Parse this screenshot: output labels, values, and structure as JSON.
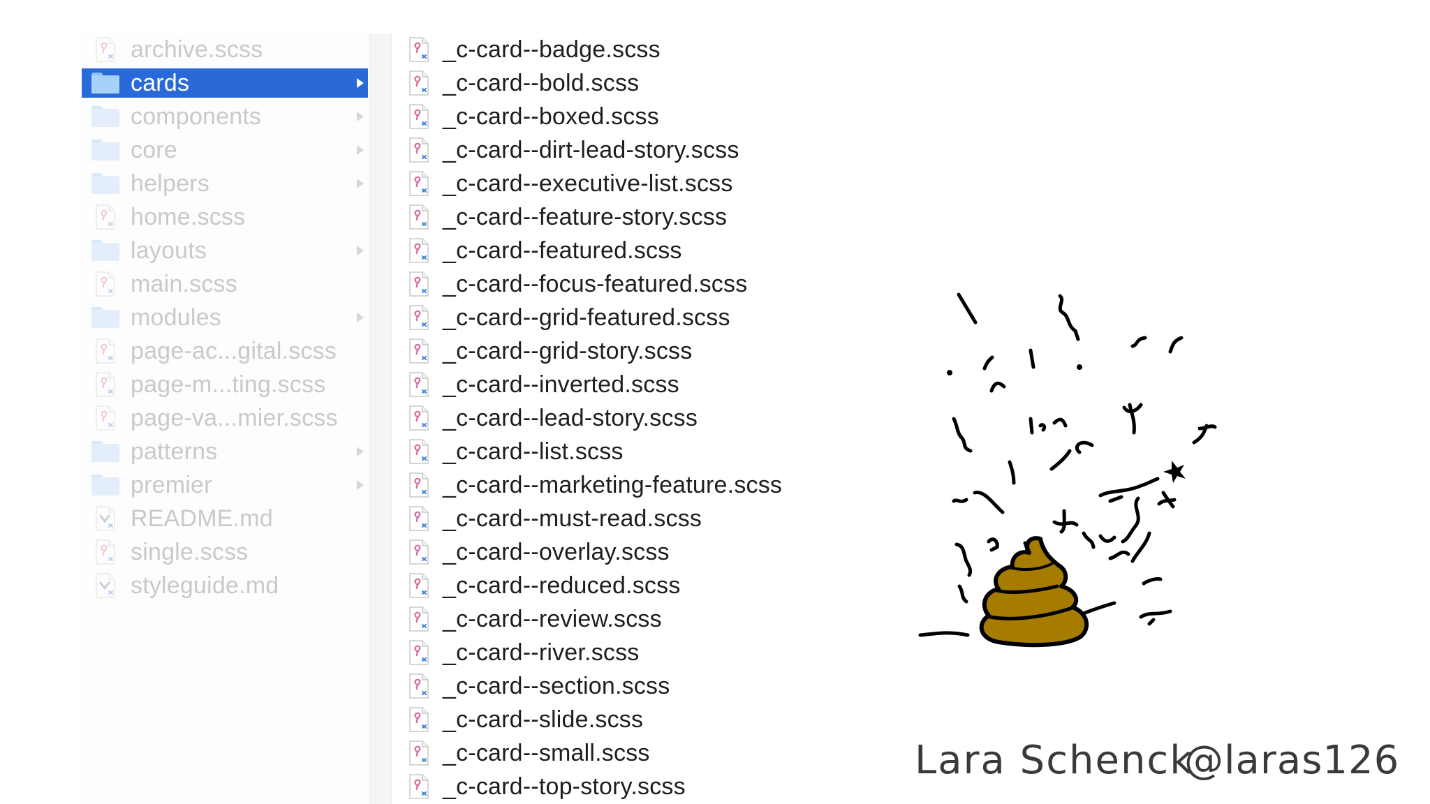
{
  "parent_directory": {
    "items": [
      {
        "label": "archive.scss",
        "kind": "scss"
      },
      {
        "label": "cards",
        "kind": "folder",
        "selected": true
      },
      {
        "label": "components",
        "kind": "folder"
      },
      {
        "label": "core",
        "kind": "folder"
      },
      {
        "label": "helpers",
        "kind": "folder"
      },
      {
        "label": "home.scss",
        "kind": "scss"
      },
      {
        "label": "layouts",
        "kind": "folder"
      },
      {
        "label": "main.scss",
        "kind": "scss"
      },
      {
        "label": "modules",
        "kind": "folder"
      },
      {
        "label": "page-ac...gital.scss",
        "kind": "scss"
      },
      {
        "label": "page-m...ting.scss",
        "kind": "scss"
      },
      {
        "label": "page-va...mier.scss",
        "kind": "scss"
      },
      {
        "label": "patterns",
        "kind": "folder"
      },
      {
        "label": "premier",
        "kind": "folder"
      },
      {
        "label": "README.md",
        "kind": "md"
      },
      {
        "label": "single.scss",
        "kind": "scss"
      },
      {
        "label": "styleguide.md",
        "kind": "md"
      }
    ]
  },
  "cards_directory": {
    "items": [
      "_c-card--badge.scss",
      "_c-card--bold.scss",
      "_c-card--boxed.scss",
      "_c-card--dirt-lead-story.scss",
      "_c-card--executive-list.scss",
      "_c-card--feature-story.scss",
      "_c-card--featured.scss",
      "_c-card--focus-featured.scss",
      "_c-card--grid-featured.scss",
      "_c-card--grid-story.scss",
      "_c-card--inverted.scss",
      "_c-card--lead-story.scss",
      "_c-card--list.scss",
      "_c-card--marketing-feature.scss",
      "_c-card--must-read.scss",
      "_c-card--overlay.scss",
      "_c-card--reduced.scss",
      "_c-card--review.scss",
      "_c-card--river.scss",
      "_c-card--section.scss",
      "_c-card--slide.scss",
      "_c-card--small.scss",
      "_c-card--top-story.scss"
    ]
  },
  "signature": {
    "name": "Lara Schenck",
    "handle": "@laras126"
  },
  "icons": {
    "folder": "folder-icon",
    "scss_file": "scss-file-icon",
    "markdown_file": "markdown-file-icon",
    "disclosure": "chevron-right-icon",
    "drawing": "poop-pile-drawing"
  },
  "colors": {
    "selection": "#2a6ad8",
    "folder_light": "#e3eefa",
    "dimmed_text": "#c9c9c9",
    "file_text": "#1e1e1e",
    "poop": "#a67c00",
    "ink": "#000000"
  }
}
